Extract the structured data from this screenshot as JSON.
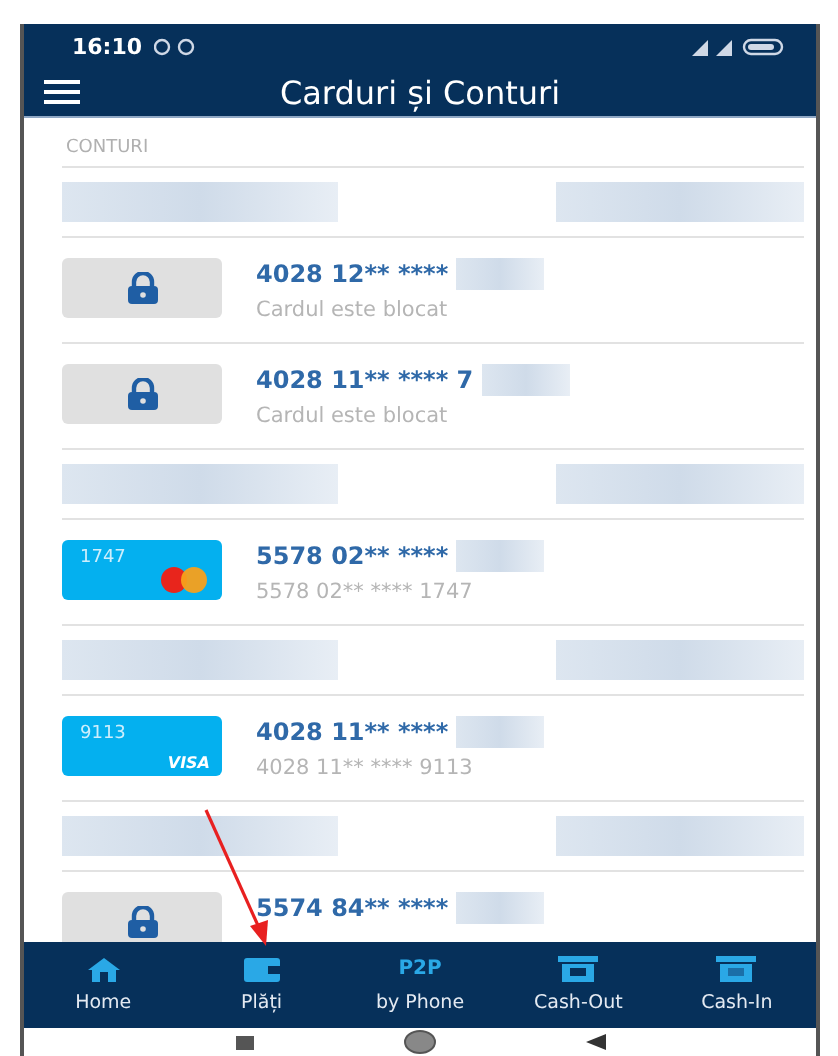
{
  "status_bar": {
    "time": "16:10"
  },
  "header": {
    "title": "Carduri și Conturi"
  },
  "section": {
    "label": "CONTURI"
  },
  "rows": [
    {
      "kind": "account"
    },
    {
      "kind": "locked",
      "number": "4028 12** ****",
      "subtitle": "Cardul este blocat"
    },
    {
      "kind": "locked",
      "number": "4028 11** **** 7",
      "subtitle": "Cardul este blocat"
    },
    {
      "kind": "account"
    },
    {
      "kind": "mastercard",
      "card_digits": "1747",
      "number": "5578 02** ****",
      "subtitle": "5578 02** **** 1747"
    },
    {
      "kind": "account"
    },
    {
      "kind": "visa",
      "card_digits": "9113",
      "brand": "VISA",
      "number": "4028 11** ****",
      "subtitle": "4028 11** **** 9113"
    },
    {
      "kind": "account"
    },
    {
      "kind": "locked",
      "number": "5574 84** ****"
    }
  ],
  "bottom_nav": [
    {
      "kind": "home",
      "label": "Home"
    },
    {
      "kind": "wallet",
      "label": "Plăți"
    },
    {
      "kind": "text",
      "icon_text": "P2P",
      "label": "by Phone"
    },
    {
      "kind": "cash-out",
      "label": "Cash-Out"
    },
    {
      "kind": "cash-in",
      "label": "Cash-In"
    }
  ]
}
